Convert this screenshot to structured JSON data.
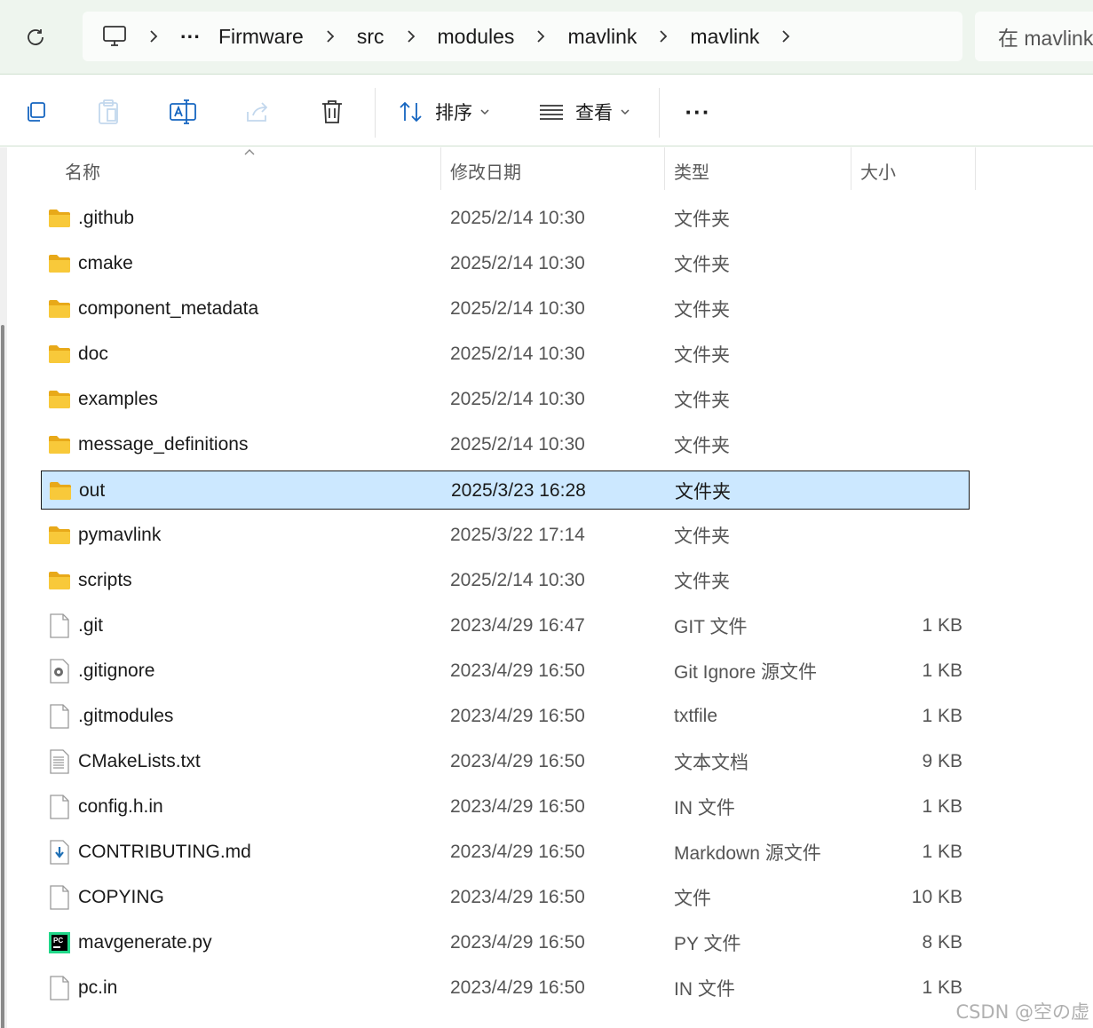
{
  "breadcrumb": {
    "ellipsis": "···",
    "segments": [
      "Firmware",
      "src",
      "modules",
      "mavlink",
      "mavlink"
    ]
  },
  "search": {
    "placeholder": "在 mavlink"
  },
  "toolbar": {
    "sort_label": "排序",
    "view_label": "查看",
    "more_label": "···"
  },
  "columns": {
    "name": "名称",
    "date": "修改日期",
    "type": "类型",
    "size": "大小"
  },
  "files": [
    {
      "name": ".github",
      "date": "2025/2/14 10:30",
      "type": "文件夹",
      "size": "",
      "icon": "folder-icon"
    },
    {
      "name": "cmake",
      "date": "2025/2/14 10:30",
      "type": "文件夹",
      "size": "",
      "icon": "folder-icon"
    },
    {
      "name": "component_metadata",
      "date": "2025/2/14 10:30",
      "type": "文件夹",
      "size": "",
      "icon": "folder-icon"
    },
    {
      "name": "doc",
      "date": "2025/2/14 10:30",
      "type": "文件夹",
      "size": "",
      "icon": "folder-icon"
    },
    {
      "name": "examples",
      "date": "2025/2/14 10:30",
      "type": "文件夹",
      "size": "",
      "icon": "folder-icon"
    },
    {
      "name": "message_definitions",
      "date": "2025/2/14 10:30",
      "type": "文件夹",
      "size": "",
      "icon": "folder-icon"
    },
    {
      "name": "out",
      "date": "2025/3/23 16:28",
      "type": "文件夹",
      "size": "",
      "icon": "folder-icon",
      "selected": true
    },
    {
      "name": "pymavlink",
      "date": "2025/3/22 17:14",
      "type": "文件夹",
      "size": "",
      "icon": "folder-icon"
    },
    {
      "name": "scripts",
      "date": "2025/2/14 10:30",
      "type": "文件夹",
      "size": "",
      "icon": "folder-icon"
    },
    {
      "name": ".git",
      "date": "2023/4/29 16:47",
      "type": "GIT 文件",
      "size": "1 KB",
      "icon": "blank-file-icon"
    },
    {
      "name": ".gitignore",
      "date": "2023/4/29 16:50",
      "type": "Git Ignore 源文件",
      "size": "1 KB",
      "icon": "settings-file-icon"
    },
    {
      "name": ".gitmodules",
      "date": "2023/4/29 16:50",
      "type": "txtfile",
      "size": "1 KB",
      "icon": "blank-file-icon"
    },
    {
      "name": "CMakeLists.txt",
      "date": "2023/4/29 16:50",
      "type": "文本文档",
      "size": "9 KB",
      "icon": "text-file-icon"
    },
    {
      "name": "config.h.in",
      "date": "2023/4/29 16:50",
      "type": "IN 文件",
      "size": "1 KB",
      "icon": "blank-file-icon"
    },
    {
      "name": "CONTRIBUTING.md",
      "date": "2023/4/29 16:50",
      "type": "Markdown 源文件",
      "size": "1 KB",
      "icon": "markdown-file-icon"
    },
    {
      "name": "COPYING",
      "date": "2023/4/29 16:50",
      "type": "文件",
      "size": "10 KB",
      "icon": "blank-file-icon"
    },
    {
      "name": "mavgenerate.py",
      "date": "2023/4/29 16:50",
      "type": "PY 文件",
      "size": "8 KB",
      "icon": "pycharm-file-icon"
    },
    {
      "name": "pc.in",
      "date": "2023/4/29 16:50",
      "type": "IN 文件",
      "size": "1 KB",
      "icon": "blank-file-icon"
    }
  ],
  "watermark": "CSDN @空の虚",
  "colors": {
    "selection_bg": "#cce8ff",
    "folder": "#f8c93a",
    "address_bg": "#eef5ee"
  }
}
